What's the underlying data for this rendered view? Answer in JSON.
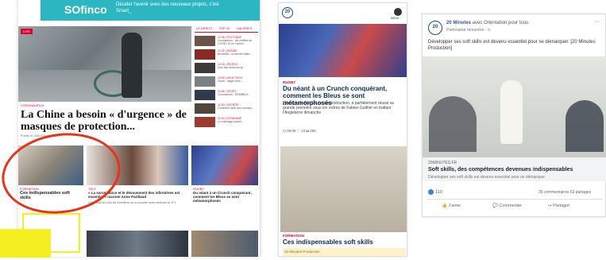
{
  "panel1": {
    "ad_logo": "SOfinco",
    "ad_text": "Décider l'avenir avec des nouveaux projets, c'est Smart_",
    "red_tag": "LIVE",
    "tabs": [
      "LE DIRECT",
      "TOP 20",
      "GALERIES"
    ],
    "sidebar_items": [
      {
        "tag": "12:45 | POLITIQUE",
        "text": "Coronavirus : les chiffres du COVID-19 en France"
      },
      {
        "tag": "12:30 | MONDE",
        "text": "Bruxelles : le dernier bilan..."
      },
      {
        "tag": "12:15 | PEOPLE",
        "text": "Une star annonce la..."
      },
      {
        "tag": "12:00 | HIGH-TECH",
        "text": "Zoom : l'appli visio..."
      },
      {
        "tag": "11:45 | SPORT",
        "text": "Coronavirus : DEMBELE..."
      },
      {
        "tag": "11:30 | SOCIÉTÉ",
        "text": "Comment faire ses courses..."
      },
      {
        "tag": "11:15 | ÉCONOMIE",
        "text": "Le chômage partiel..."
      }
    ],
    "kicker": "CORONAVIRUS",
    "headline": "La Chine a besoin « d'urgence » de masques de protection...",
    "meta": "Publié le 03/02/20 à 12h00",
    "cards": [
      {
        "kicker": "FORMATION",
        "title": "Ces indispensables soft skills",
        "desc": ""
      },
      {
        "kicker": "TÉLÉ",
        "title": "« La surveillance et le dévouement des infirmières est essentiel » raconte Anne Parillaud",
        "desc": "L'interview de Luce les infirmières de la nouvelle série médicale de TF1"
      },
      {
        "kicker": "RUGBY",
        "title": "Du néant à un Crunch conquérant, comment les Bleus se sont métamorphosés",
        "desc": ""
      }
    ]
  },
  "panel2": {
    "logo": "20",
    "menu_label": "MENU",
    "kicker1": "RUGBY",
    "title1": "Du néant à un Crunch conquérant, comment les Bleus se sont métamorphosés",
    "desc1": "L'équipe de France, en reconstruction, a parfaitement réussi sa grande première sous les ordres de Fabien Galthié en battant l'Angleterre dimanche",
    "meta1": "◷ 06:05  ♡ 13  ⇄ 255",
    "kicker2": "FORMATION",
    "title2": "Ces indispensables soft skills",
    "sponsor": "20 Minutes Production"
  },
  "panel3": {
    "avatar": "20",
    "page_name": "20 Minutes",
    "with_text": " avec Orientation pour tous.",
    "sponsored": "Partenariat rémunéré · ⊙",
    "dots": "···",
    "message": "Développer ses soft skills est devenu essentiel pour se démarquer. [20 Minutes Production]",
    "source": "20MINUTES.FR",
    "link_title": "Soft skills, des compétences devenues indispensables",
    "link_sub": "Développer ses soft skills est devenu essentiel pour se démarquer",
    "reactions": "110",
    "stats": "35 commentaires  63 partages",
    "actions": [
      "J'aime",
      "Commenter",
      "Partager"
    ]
  }
}
